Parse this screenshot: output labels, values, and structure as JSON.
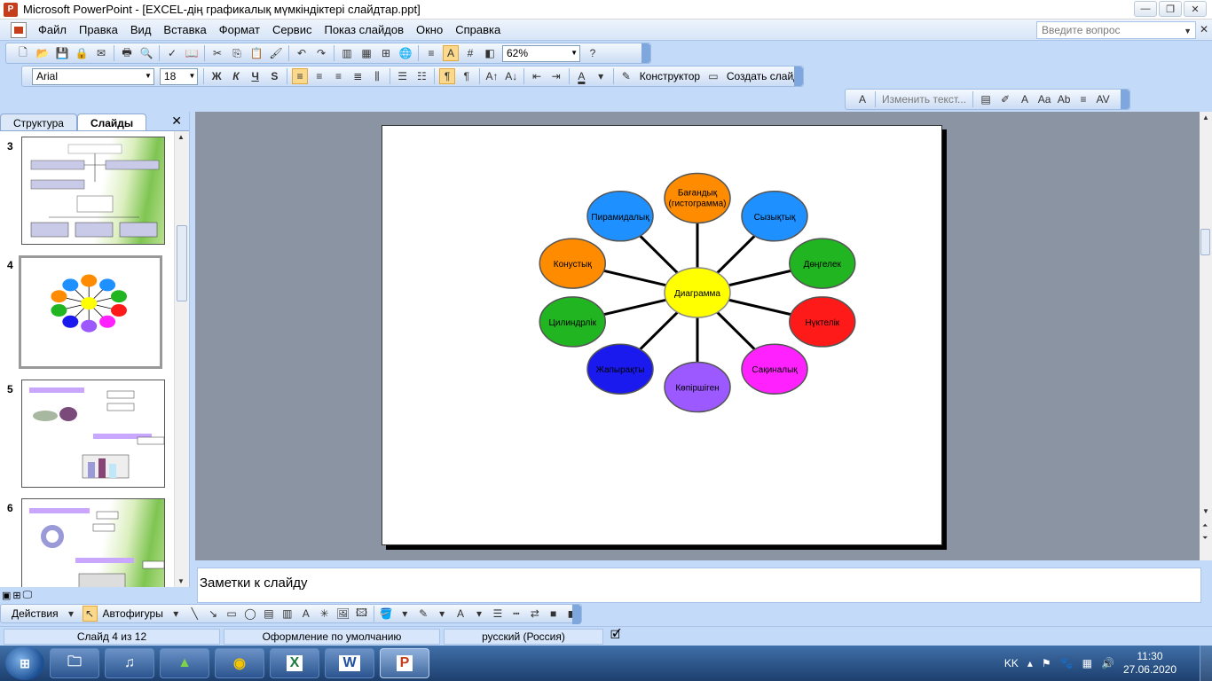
{
  "window": {
    "title": "Microsoft PowerPoint - [EXCEL-дің графикалық мүмкіндіктері слайдтар.ppt]",
    "app_icon_text": "P",
    "controls": {
      "minimize": "—",
      "restore": "❐",
      "close": "✕"
    }
  },
  "menu": {
    "items": [
      "Файл",
      "Правка",
      "Вид",
      "Вставка",
      "Формат",
      "Сервис",
      "Показ слайдов",
      "Окно",
      "Справка"
    ],
    "ask_placeholder": "Введите вопрос",
    "doc_close": "✕"
  },
  "standard_toolbar": {
    "zoom": "62%"
  },
  "format_toolbar": {
    "font": "Arial",
    "size": "18",
    "bold": "Ж",
    "italic": "К",
    "underline": "Ч",
    "shadow": "S",
    "designer": "Конструктор",
    "new_slide": "Создать слайд"
  },
  "wordart_toolbar": {
    "edit_text": "Изменить текст..."
  },
  "outline_pane": {
    "tabs": [
      "Структура",
      "Слайды"
    ],
    "close": "✕",
    "thumbnails": [
      {
        "number": "3"
      },
      {
        "number": "4"
      },
      {
        "number": "5"
      },
      {
        "number": "6"
      }
    ]
  },
  "slide": {
    "center": {
      "label": "Диаграмма",
      "color": "#ffff00"
    },
    "nodes": [
      {
        "label": "Бағандық (гистограмма)",
        "line1": "Бағандық",
        "line2": "(гистограмма)",
        "color": "#ff8c00"
      },
      {
        "label": "Сызықтық",
        "color": "#1e90ff"
      },
      {
        "label": "Дөңгелек",
        "color": "#22b522"
      },
      {
        "label": "Нүктелік",
        "color": "#ff1a1a"
      },
      {
        "label": "Сақиналық",
        "color": "#ff22ff"
      },
      {
        "label": "Көпіршіген",
        "color": "#9b59ff"
      },
      {
        "label": "Жапырақты",
        "color": "#1a1aee"
      },
      {
        "label": "Цилиндрлік",
        "color": "#22b522"
      },
      {
        "label": "Конустық",
        "color": "#ff8c00"
      },
      {
        "label": "Пирамидалық",
        "color": "#1e90ff"
      }
    ]
  },
  "notes": {
    "placeholder": "Заметки к слайду"
  },
  "draw_toolbar": {
    "actions": "Действия",
    "autoshapes": "Автофигуры"
  },
  "statusbar": {
    "slide": "Слайд 4 из 12",
    "design": "Оформление по умолчанию",
    "language": "русский (Россия)"
  },
  "taskbar": {
    "lang": "KK",
    "time": "11:30",
    "date": "27.06.2020"
  }
}
